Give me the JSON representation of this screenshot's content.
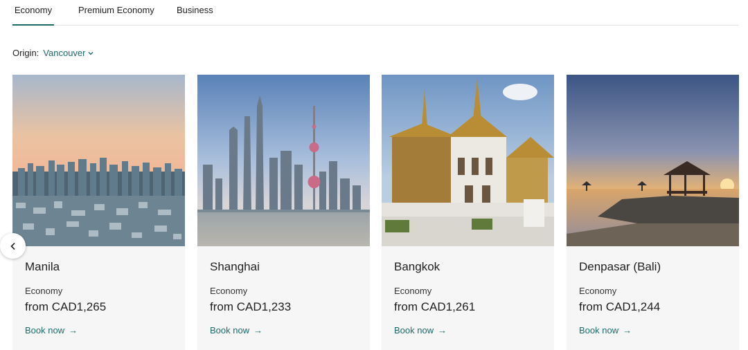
{
  "tabs": [
    {
      "label": "Economy",
      "active": true
    },
    {
      "label": "Premium Economy",
      "active": false
    },
    {
      "label": "Business",
      "active": false
    }
  ],
  "origin": {
    "label": "Origin:",
    "value": "Vancouver"
  },
  "carousel": {
    "prev_icon": "chevron-left-icon"
  },
  "cards": [
    {
      "city": "Manila",
      "cabin": "Economy",
      "price": "from CAD1,265",
      "cta": "Book now",
      "cta_icon": "arrow-right-icon"
    },
    {
      "city": "Shanghai",
      "cabin": "Economy",
      "price": "from CAD1,233",
      "cta": "Book now",
      "cta_icon": "arrow-right-icon"
    },
    {
      "city": "Bangkok",
      "cabin": "Economy",
      "price": "from CAD1,261",
      "cta": "Book now",
      "cta_icon": "arrow-right-icon"
    },
    {
      "city": "Denpasar (Bali)",
      "cabin": "Economy",
      "price": "from CAD1,244",
      "cta": "Book now",
      "cta_icon": "arrow-right-icon"
    }
  ],
  "colors": {
    "accent": "#1b6a68",
    "card_bg": "#f6f6f6",
    "divider": "#e3e3e3"
  }
}
